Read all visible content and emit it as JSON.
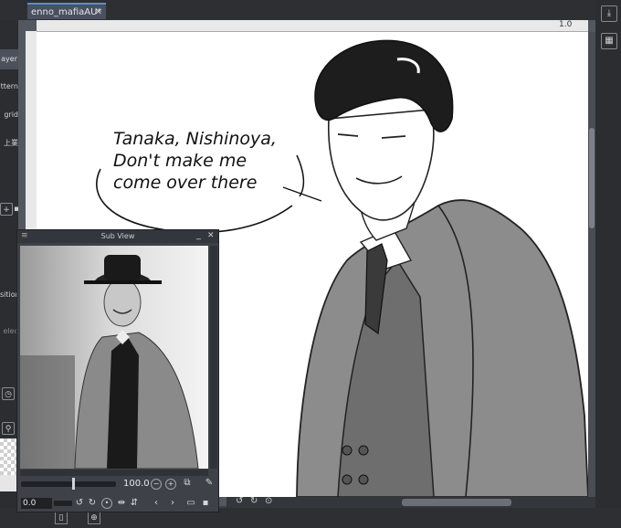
{
  "document_tab": {
    "title": "enno_mafiaAU*",
    "close_label": "✕"
  },
  "left_panel": {
    "items": [
      "ayer",
      "ttern",
      "grid",
      "上業"
    ],
    "labels": [
      "sition",
      "elec"
    ]
  },
  "canvas": {
    "zoom_label": "1.0",
    "speech_lines": [
      "Tanaka, Nishinoya,",
      "Don't make me",
      "come over there"
    ]
  },
  "subview": {
    "title": "Sub View",
    "zoom_value": "100.0",
    "rotation_value": "0.0"
  },
  "colors": {
    "background": "#3c3f45",
    "panel": "#2b2d31",
    "canvas": "#ffffff",
    "accent": "#5b8bd6"
  },
  "icons": [
    "zoom-out-icon",
    "zoom-in-icon",
    "fit-icon",
    "eyedropper-icon",
    "rotate-left-icon",
    "rotate-right-icon",
    "reset-icon",
    "flip-horizontal-icon",
    "flip-vertical-icon",
    "prev-icon",
    "next-icon",
    "folder-icon",
    "trash-icon",
    "export-icon",
    "grid-icon"
  ]
}
